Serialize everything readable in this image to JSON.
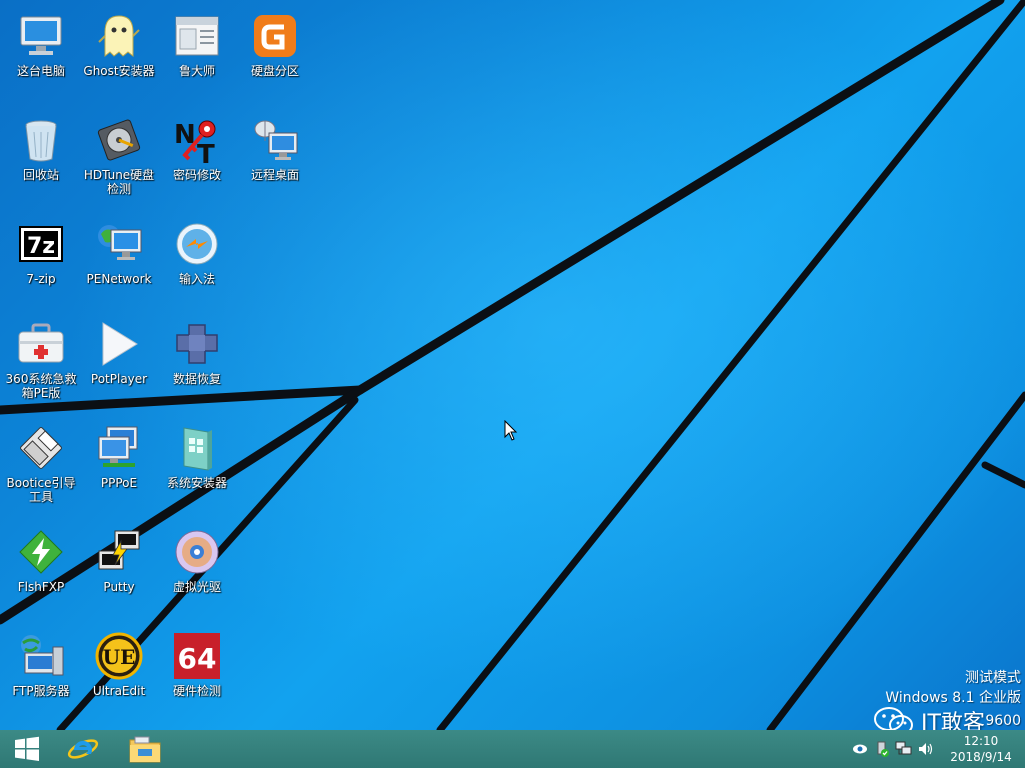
{
  "desktop": {
    "icons": [
      {
        "label": "这台电脑",
        "icon": "computer-icon"
      },
      {
        "label": "Ghost安装器",
        "icon": "ghost-icon"
      },
      {
        "label": "鲁大师",
        "icon": "ludashi-icon"
      },
      {
        "label": "硬盘分区",
        "icon": "diskgenius-icon"
      },
      {
        "label": "回收站",
        "icon": "recycle-bin-icon"
      },
      {
        "label": "HDTune硬盘检测",
        "icon": "hdtune-icon"
      },
      {
        "label": "密码修改",
        "icon": "password-key-icon"
      },
      {
        "label": "远程桌面",
        "icon": "remote-desktop-icon"
      },
      {
        "label": "7-zip",
        "icon": "7zip-icon"
      },
      {
        "label": "PENetwork",
        "icon": "network-icon"
      },
      {
        "label": "输入法",
        "icon": "input-method-icon"
      },
      {
        "label": "360系统急救箱PE版",
        "icon": "first-aid-kit-icon"
      },
      {
        "label": "PotPlayer",
        "icon": "play-icon"
      },
      {
        "label": "数据恢复",
        "icon": "puzzle-icon"
      },
      {
        "label": "Bootice引导工具",
        "icon": "floppy-icon"
      },
      {
        "label": "PPPoE",
        "icon": "pppoe-icon"
      },
      {
        "label": "系统安装器",
        "icon": "installer-icon"
      },
      {
        "label": "FlshFXP",
        "icon": "flashfxp-icon"
      },
      {
        "label": "Putty",
        "icon": "putty-icon"
      },
      {
        "label": "虚拟光驱",
        "icon": "optical-disc-icon"
      },
      {
        "label": "FTP服务器",
        "icon": "ftp-server-icon"
      },
      {
        "label": "UltraEdit",
        "icon": "ultraedit-icon"
      },
      {
        "label": "硬件检测",
        "icon": "aida64-icon"
      }
    ]
  },
  "watermark": {
    "line1": "测试模式",
    "line2": "Windows 8.1 企业版",
    "line3": "9600"
  },
  "overlay": {
    "text": "IT敢客"
  },
  "taskbar": {
    "start": "start-icon",
    "pinned": [
      "internet-explorer-icon",
      "file-explorer-icon"
    ],
    "tray_icons": [
      "eye-icon",
      "usb-icon",
      "network-icon",
      "volume-icon"
    ],
    "time": "12:10",
    "date": "2018/9/14"
  },
  "colors": {
    "accent": "#1596e6",
    "taskbar": "#2f7874"
  }
}
